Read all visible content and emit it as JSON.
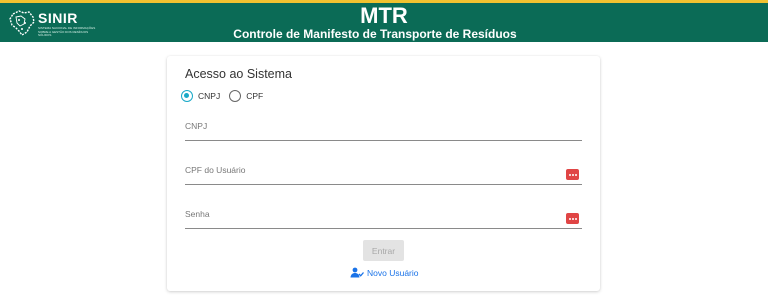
{
  "header": {
    "logo_text": "SINIR",
    "logo_subtitle": "SISTEMA NACIONAL DE INFORMAÇÕES SOBRE A GESTÃO DOS RESÍDUOS SÓLIDOS",
    "title": "MTR",
    "subtitle": "Controle de Manifesto de Transporte de Resíduos"
  },
  "login": {
    "title": "Acesso ao Sistema",
    "doc_types": [
      {
        "label": "CNPJ",
        "checked": true
      },
      {
        "label": "CPF",
        "checked": false
      }
    ],
    "fields": {
      "cnpj": {
        "label": "CNPJ",
        "value": ""
      },
      "cpf_usuario": {
        "label": "CPF do Usuário",
        "value": ""
      },
      "senha": {
        "label": "Senha",
        "value": ""
      }
    },
    "submit_label": "Entrar",
    "new_user_label": "Novo Usuário"
  },
  "colors": {
    "header_bg": "#0b6b56",
    "top_accent": "#f2c230",
    "radio_accent": "#1aa9c8",
    "key_icon": "#e04545",
    "link": "#1a73e8"
  },
  "icons": {
    "brazil_map": "brazil-map-icon",
    "password_key": "password-dots-icon",
    "add_user": "add-user-icon"
  }
}
